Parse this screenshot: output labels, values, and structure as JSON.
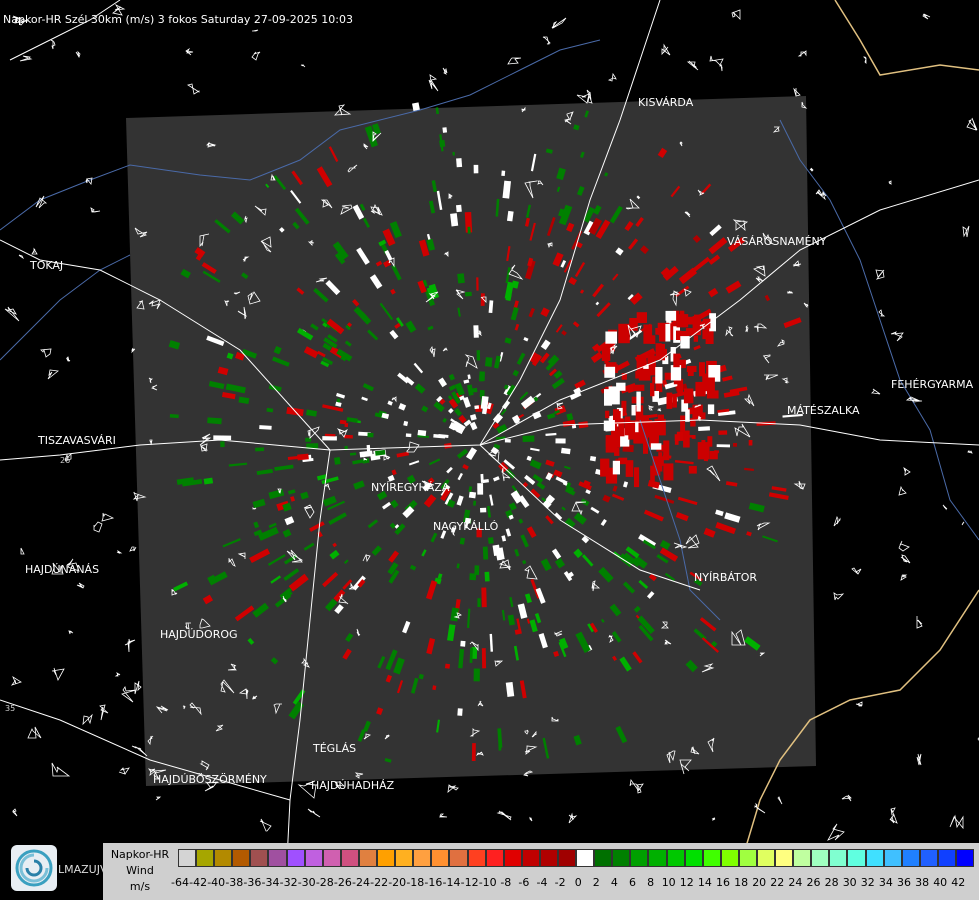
{
  "title": "Napkor-HR Szél 30km (m/s) 3 fokos Saturday 27-09-2025 10:03",
  "cities": [
    {
      "name": "KISVÁRDA"
    },
    {
      "name": "TOKAJ"
    },
    {
      "name": "VÁSÁROSNAMÉNY"
    },
    {
      "name": "FEHÉRGYARMA"
    },
    {
      "name": "MÁTÉSZALKA"
    },
    {
      "name": "TISZAVASVÁRI"
    },
    {
      "name": "NYÍREGYHÁZA"
    },
    {
      "name": "NAGYKÁLLÓ"
    },
    {
      "name": "HAJDÚNÁNÁS"
    },
    {
      "name": "NYÍRBÁTOR"
    },
    {
      "name": "HAJDÚDOROG"
    },
    {
      "name": "TÉGLÁS"
    },
    {
      "name": "HAJDÚBÖSZÖRMÉNY"
    },
    {
      "name": "HAJDÚHADHÁZ"
    }
  ],
  "road_numbers": [
    "26",
    "35"
  ],
  "legend": {
    "line1": "Napkor-HR",
    "line2": "Wind",
    "line3": "m/s",
    "ticks": [
      "-64",
      "-42",
      "-40",
      "-38",
      "-36",
      "-34",
      "-32",
      "-30",
      "-28",
      "-26",
      "-24",
      "-22",
      "-20",
      "-18",
      "-16",
      "-14",
      "-12",
      "-10",
      "-8",
      "-6",
      "-4",
      "-2",
      "0",
      "2",
      "4",
      "6",
      "8",
      "10",
      "12",
      "14",
      "16",
      "18",
      "20",
      "22",
      "24",
      "26",
      "28",
      "30",
      "32",
      "34",
      "36",
      "38",
      "40",
      "42"
    ],
    "colors": [
      "#d4d4d4",
      "#a6a600",
      "#b38a00",
      "#b35a00",
      "#a05050",
      "#a050a0",
      "#a050ff",
      "#c060e0",
      "#d060b0",
      "#d05080",
      "#e08040",
      "#ffa000",
      "#ffb020",
      "#ffa040",
      "#ff9030",
      "#e07040",
      "#ff4020",
      "#ff2020",
      "#e00000",
      "#c00000",
      "#b00000",
      "#a00000",
      "#ffffff",
      "#007000",
      "#008000",
      "#00a000",
      "#00b000",
      "#00c800",
      "#00e000",
      "#40ff00",
      "#80ff00",
      "#a0ff40",
      "#e0ff60",
      "#ffff80",
      "#c0ffa0",
      "#a0ffc0",
      "#80ffd0",
      "#60ffe0",
      "#40e0ff",
      "#40c0ff",
      "#2080ff",
      "#2060ff",
      "#1040ff",
      "#0000ff"
    ]
  },
  "logo_text": "LMAZUJVAR"
}
